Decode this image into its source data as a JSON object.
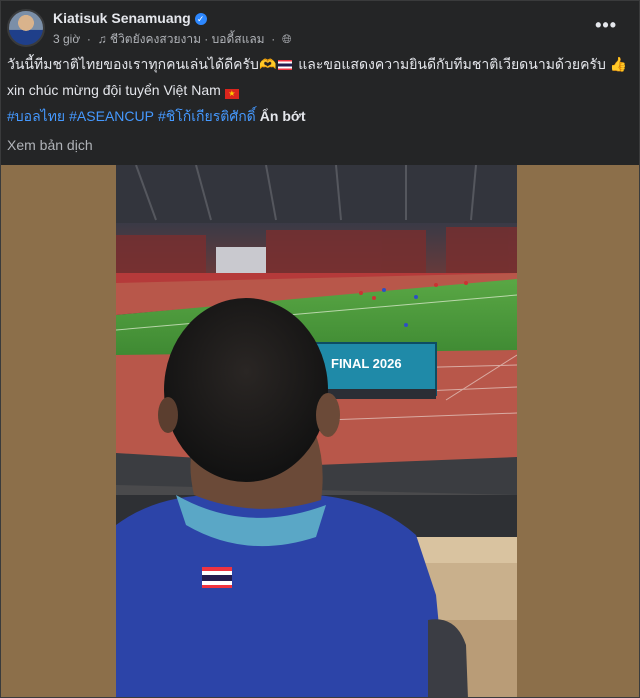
{
  "post": {
    "author": "Kiatisuk Senamuang",
    "time": "3 giờ",
    "music": "ชีวิตยังคงสวยงาม · บอดี้สแลม",
    "privacy_icon": "globe-icon",
    "menu_icon": "more-options-icon",
    "text_line1": "วันนี้ทีมชาติไทยของเราทุกคนเล่นได้ดีครับ",
    "text_line1b": "และขอแสดงความยินดีกับทีมชาติเวียดนามด้วยครับ",
    "text_line2": "xin chúc mừng đội tuyển Việt Nam",
    "hashtags": [
      "#บอลไทย",
      "#ASEANCUP",
      "#ชิโก้เกียรติศักดิ์"
    ],
    "see_less": "Ẩn bớt",
    "translate": "Xem bản dịch"
  },
  "photo": {
    "led_board_text": "FINAL 2026",
    "colors": {
      "pitch": "#4f9a3c",
      "track": "#b8574a",
      "shirt": "#2c44a8",
      "frame_bg": "#8c6f4a"
    }
  }
}
